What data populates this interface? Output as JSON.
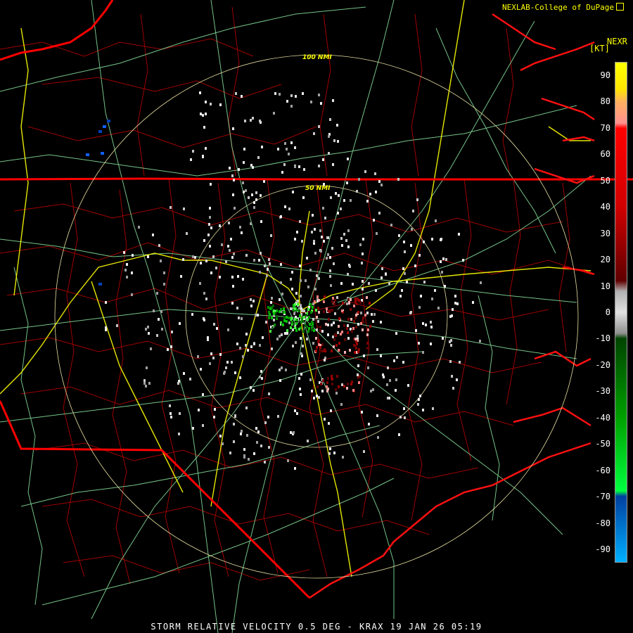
{
  "header": {
    "credit": "NEXLAB-College of DuPage",
    "credit_icon": "external-link-icon",
    "product": "NEXR",
    "units": "[KT]"
  },
  "range_rings": {
    "ring_100": "100 NMI",
    "ring_50": "50 NMI"
  },
  "colors": {
    "background": "#000000",
    "state_borders": "#ff0000",
    "county_borders": "#b00000",
    "interstates": "#ffff00",
    "highways": "#8ae6a0",
    "range_rings": "#e8e0a0"
  },
  "color_scale": {
    "labels": [
      "90",
      "80",
      "70",
      "60",
      "50",
      "40",
      "30",
      "20",
      "10",
      "0",
      "-10",
      "-20",
      "-30",
      "-40",
      "-50",
      "-60",
      "-70",
      "-80",
      "-90"
    ],
    "min": -95,
    "max": 95,
    "stops": [
      {
        "value": 95,
        "color": "#ffff00"
      },
      {
        "value": 85,
        "color": "#ffe600"
      },
      {
        "value": 80,
        "color": "#ffb060"
      },
      {
        "value": 72,
        "color": "#ff9090"
      },
      {
        "value": 70,
        "color": "#ff0000"
      },
      {
        "value": 40,
        "color": "#d00000"
      },
      {
        "value": 20,
        "color": "#800000"
      },
      {
        "value": 12,
        "color": "#600000"
      },
      {
        "value": 8,
        "color": "#b0b0b0"
      },
      {
        "value": 0,
        "color": "#e0e0e0"
      },
      {
        "value": -8,
        "color": "#909090"
      },
      {
        "value": -10,
        "color": "#004400"
      },
      {
        "value": -40,
        "color": "#00a000"
      },
      {
        "value": -68,
        "color": "#00ff40"
      },
      {
        "value": -70,
        "color": "#0040a0"
      },
      {
        "value": -95,
        "color": "#00b0ff"
      }
    ]
  },
  "caption": "STORM RELATIVE VELOCITY 0.5 DEG - KRAX 19 JAN 26 05:19"
}
